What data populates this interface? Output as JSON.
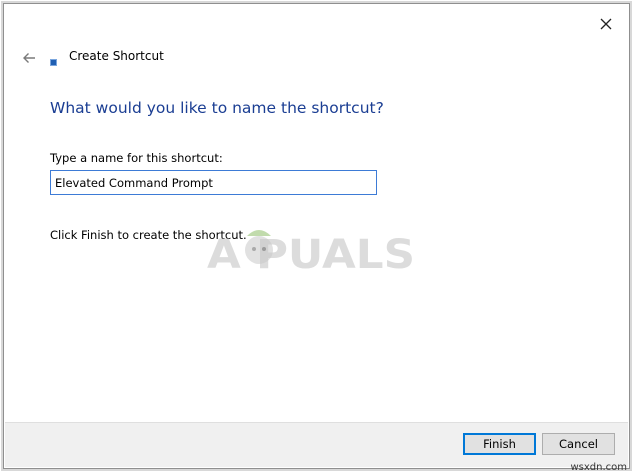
{
  "window": {
    "title": "Create Shortcut",
    "heading": "What would you like to name the shortcut?"
  },
  "form": {
    "label": "Type a name for this shortcut:",
    "value": "Elevated Command Prompt"
  },
  "hint": "Click Finish to create the shortcut.",
  "buttons": {
    "finish": "Finish",
    "cancel": "Cancel"
  },
  "watermark": {
    "text": "A PUALS"
  },
  "credit": "wsxdn.com",
  "colors": {
    "heading": "#1b3e93",
    "input_focus_border": "#3d7bd6",
    "footer_bg": "#f0f0f0",
    "default_button_border": "#0078d7"
  },
  "icons": {
    "close": "close-icon",
    "back": "back-arrow-icon",
    "title": "shortcut-icon"
  }
}
